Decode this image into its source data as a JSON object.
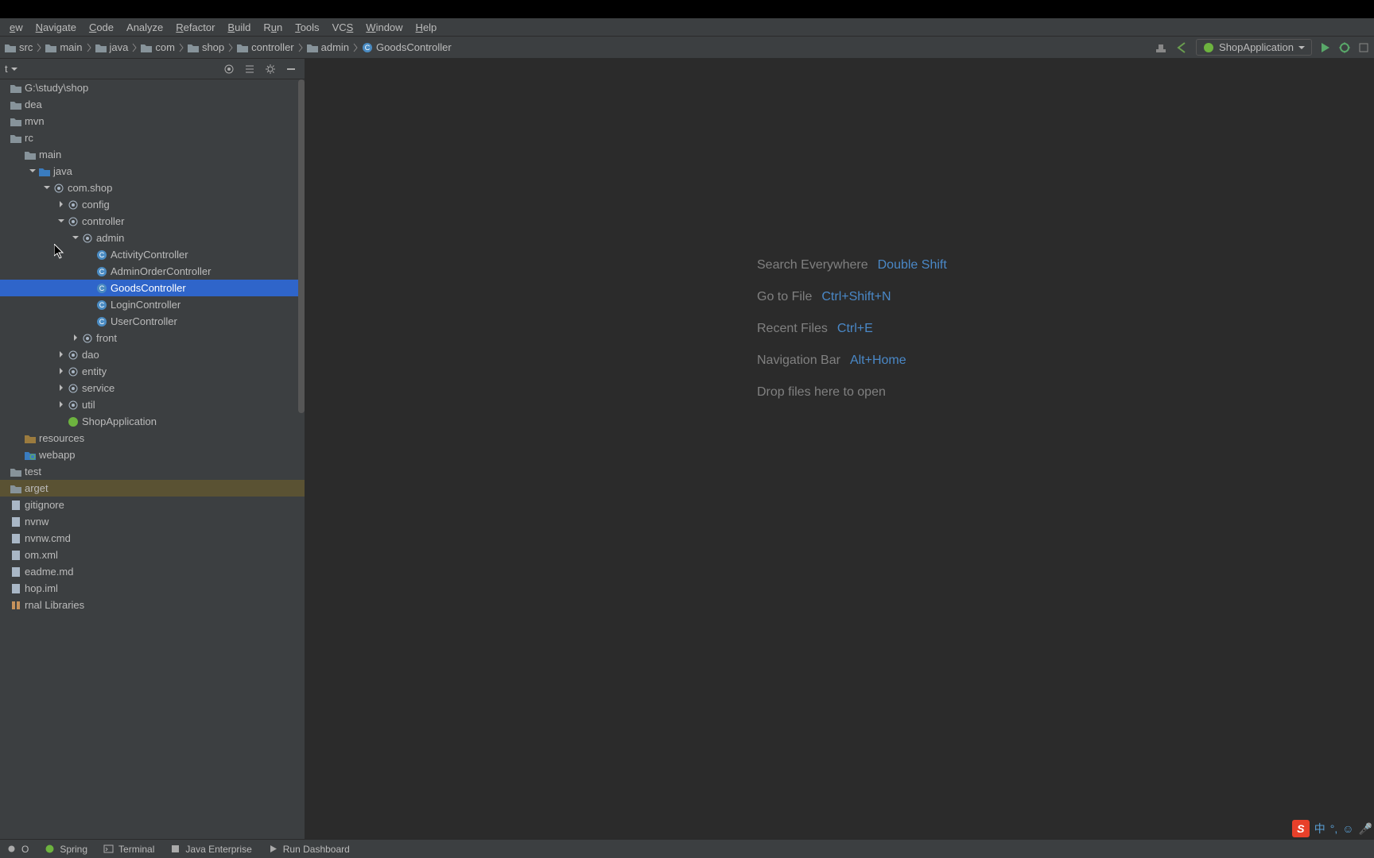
{
  "menu": [
    "ew",
    "Navigate",
    "Code",
    "Analyze",
    "Refactor",
    "Build",
    "Run",
    "Tools",
    "VCS",
    "Window",
    "Help"
  ],
  "menuUnderline": [
    0,
    0,
    0,
    -1,
    0,
    0,
    1,
    0,
    2,
    0,
    0
  ],
  "breadcrumbs": [
    {
      "label": "src",
      "icon": "folder"
    },
    {
      "label": "main",
      "icon": "folder"
    },
    {
      "label": "java",
      "icon": "folder"
    },
    {
      "label": "com",
      "icon": "folder"
    },
    {
      "label": "shop",
      "icon": "folder"
    },
    {
      "label": "controller",
      "icon": "folder"
    },
    {
      "label": "admin",
      "icon": "folder"
    },
    {
      "label": "GoodsController",
      "icon": "class"
    }
  ],
  "runConfig": "ShopApplication",
  "projectTitle": "t",
  "tree": [
    {
      "indent": 0,
      "arrow": "",
      "icon": "folder",
      "label": "G:\\study\\shop"
    },
    {
      "indent": 0,
      "arrow": "",
      "icon": "folder",
      "label": "dea"
    },
    {
      "indent": 0,
      "arrow": "",
      "icon": "folder",
      "label": "mvn"
    },
    {
      "indent": 0,
      "arrow": "",
      "icon": "folder",
      "label": "rc"
    },
    {
      "indent": 1,
      "arrow": "",
      "icon": "folder",
      "label": "main"
    },
    {
      "indent": 2,
      "arrow": "down",
      "icon": "folder-src",
      "label": "java"
    },
    {
      "indent": 3,
      "arrow": "down",
      "icon": "package",
      "label": "com.shop"
    },
    {
      "indent": 4,
      "arrow": "right",
      "icon": "package",
      "label": "config"
    },
    {
      "indent": 4,
      "arrow": "down",
      "icon": "package",
      "label": "controller"
    },
    {
      "indent": 5,
      "arrow": "down",
      "icon": "package",
      "label": "admin"
    },
    {
      "indent": 6,
      "arrow": "",
      "icon": "class",
      "label": "ActivityController"
    },
    {
      "indent": 6,
      "arrow": "",
      "icon": "class",
      "label": "AdminOrderController"
    },
    {
      "indent": 6,
      "arrow": "",
      "icon": "class",
      "label": "GoodsController",
      "sel": true
    },
    {
      "indent": 6,
      "arrow": "",
      "icon": "class",
      "label": "LoginController"
    },
    {
      "indent": 6,
      "arrow": "",
      "icon": "class",
      "label": "UserController"
    },
    {
      "indent": 5,
      "arrow": "right",
      "icon": "package",
      "label": "front"
    },
    {
      "indent": 4,
      "arrow": "right",
      "icon": "package",
      "label": "dao"
    },
    {
      "indent": 4,
      "arrow": "right",
      "icon": "package",
      "label": "entity"
    },
    {
      "indent": 4,
      "arrow": "right",
      "icon": "package",
      "label": "service"
    },
    {
      "indent": 4,
      "arrow": "right",
      "icon": "package",
      "label": "util"
    },
    {
      "indent": 4,
      "arrow": "",
      "icon": "spring",
      "label": "ShopApplication"
    },
    {
      "indent": 1,
      "arrow": "",
      "icon": "folder-res",
      "label": "resources"
    },
    {
      "indent": 1,
      "arrow": "",
      "icon": "folder-web",
      "label": "webapp"
    },
    {
      "indent": 0,
      "arrow": "",
      "icon": "folder",
      "label": "test"
    },
    {
      "indent": 0,
      "arrow": "",
      "icon": "folder",
      "label": "arget",
      "hl": true
    },
    {
      "indent": 0,
      "arrow": "",
      "icon": "file",
      "label": "gitignore"
    },
    {
      "indent": 0,
      "arrow": "",
      "icon": "file",
      "label": "nvnw"
    },
    {
      "indent": 0,
      "arrow": "",
      "icon": "file",
      "label": "nvnw.cmd"
    },
    {
      "indent": 0,
      "arrow": "",
      "icon": "file",
      "label": "om.xml"
    },
    {
      "indent": 0,
      "arrow": "",
      "icon": "file",
      "label": "eadme.md"
    },
    {
      "indent": 0,
      "arrow": "",
      "icon": "file",
      "label": "hop.iml"
    },
    {
      "indent": 0,
      "arrow": "",
      "icon": "lib",
      "label": "rnal Libraries"
    }
  ],
  "hints": [
    {
      "label": "Search Everywhere",
      "shortcut": "Double Shift"
    },
    {
      "label": "Go to File",
      "shortcut": "Ctrl+Shift+N"
    },
    {
      "label": "Recent Files",
      "shortcut": "Ctrl+E"
    },
    {
      "label": "Navigation Bar",
      "shortcut": "Alt+Home"
    },
    {
      "label": "Drop files here to open",
      "shortcut": ""
    }
  ],
  "bottomTabs": [
    {
      "icon": "todo",
      "label": "O"
    },
    {
      "icon": "spring",
      "label": "Spring"
    },
    {
      "icon": "terminal",
      "label": "Terminal"
    },
    {
      "icon": "javaee",
      "label": "Java Enterprise"
    },
    {
      "icon": "run",
      "label": "Run Dashboard"
    }
  ],
  "tray": {
    "ime": "中",
    "punct": "°,",
    "emoji": "☺",
    "mic": "🎤"
  }
}
